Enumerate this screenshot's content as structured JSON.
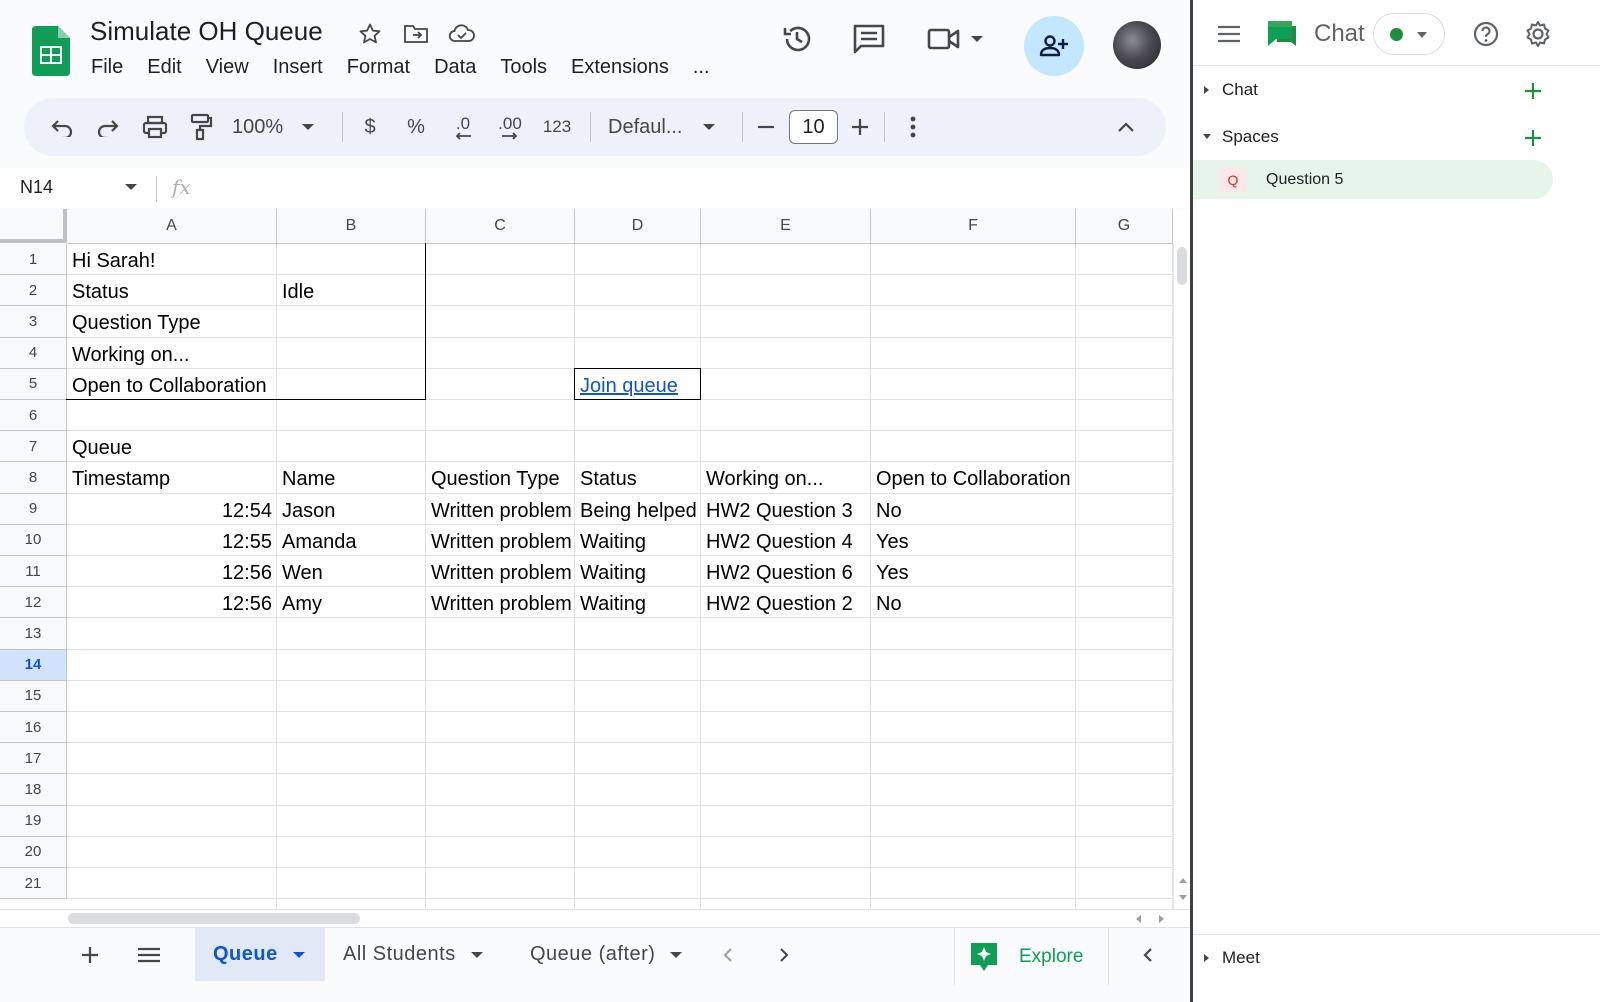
{
  "doc": {
    "title": "Simulate OH Queue",
    "menu": [
      "File",
      "Edit",
      "View",
      "Insert",
      "Format",
      "Data",
      "Tools",
      "Extensions",
      "..."
    ]
  },
  "toolbar": {
    "zoom": "100%",
    "currency": "$",
    "percent": "%",
    "dec_decrease": ".0",
    "dec_increase": ".00",
    "number_format": "123",
    "font": "Defaul...",
    "font_size": "10"
  },
  "formula_bar": {
    "name_box": "N14",
    "fx": "fx"
  },
  "grid": {
    "columns": [
      "A",
      "B",
      "C",
      "D",
      "E",
      "F",
      "G"
    ],
    "rows": [
      "1",
      "2",
      "3",
      "4",
      "5",
      "6",
      "7",
      "8",
      "9",
      "10",
      "11",
      "12",
      "13",
      "14",
      "15",
      "16",
      "17",
      "18",
      "19",
      "20",
      "21"
    ],
    "active_row": "14",
    "top_section": {
      "greeting": "Hi Sarah!",
      "status_label": "Status",
      "status_value": "Idle",
      "question_type_label": "Question Type",
      "working_on_label": "Working on...",
      "collab_label": "Open to Collaboration",
      "join_link": "Join queue"
    },
    "queue_title": "Queue",
    "headers": [
      "Timestamp",
      "Name",
      "Question Type",
      "Status",
      "Working on...",
      "Open to Collaboration"
    ],
    "queue_rows": [
      [
        "12:54",
        "Jason",
        "Written problem",
        "Being helped",
        "HW2 Question 3",
        "No"
      ],
      [
        "12:55",
        "Amanda",
        "Written problem",
        "Waiting",
        "HW2 Question 4",
        "Yes"
      ],
      [
        "12:56",
        "Wen",
        "Written problem",
        "Waiting",
        "HW2 Question 6",
        "Yes"
      ],
      [
        "12:56",
        "Amy",
        "Written problem",
        "Waiting",
        "HW2 Question 2",
        "No"
      ]
    ]
  },
  "tabs": {
    "sheets": [
      "Queue",
      "All Students",
      "Queue (after)"
    ],
    "explore": "Explore"
  },
  "chat": {
    "title": "Chat",
    "sections": {
      "chat": "Chat",
      "spaces": "Spaces",
      "meet": "Meet"
    },
    "space_badge": "Q",
    "space_name": "Question 5"
  },
  "colors": {
    "accent": "#0b57d0",
    "sheets_green": "#0f9d58",
    "link": "#1155cc",
    "active_space": "#e6f4ea"
  }
}
